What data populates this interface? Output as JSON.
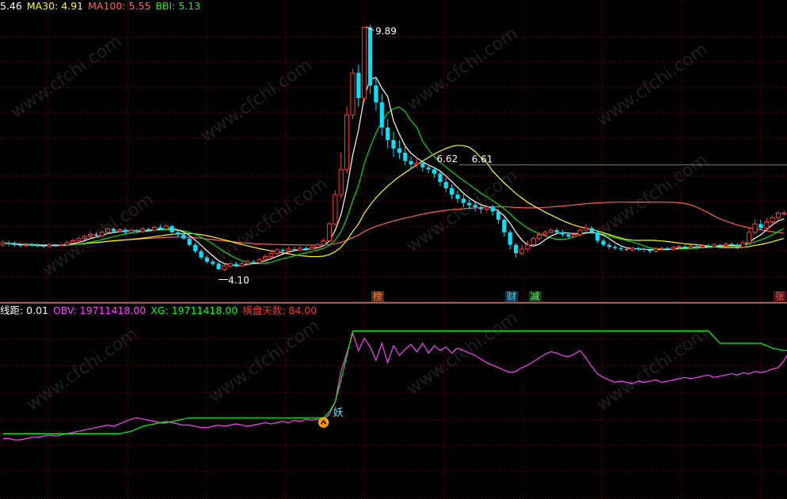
{
  "chart_data": [
    {
      "type": "candlestick",
      "legend": [
        {
          "label": "5.46",
          "color": "#ffffff"
        },
        {
          "label": "MA30: 4.91",
          "color": "#ffff00"
        },
        {
          "label": "MA100: 5.55",
          "color": "#ff5050"
        },
        {
          "label": "BBI: 5.13",
          "color": "#00ff00"
        }
      ],
      "ylim": [
        3.6,
        10.2
      ],
      "n": 140,
      "candles": [
        [
          4.7,
          4.75,
          4.82,
          4.65
        ],
        [
          4.75,
          4.72,
          4.8,
          4.68
        ],
        [
          4.72,
          4.7,
          4.78,
          4.66
        ],
        [
          4.7,
          4.68,
          4.74,
          4.64
        ],
        [
          4.68,
          4.7,
          4.75,
          4.65
        ],
        [
          4.7,
          4.69,
          4.74,
          4.66
        ],
        [
          4.69,
          4.68,
          4.72,
          4.64
        ],
        [
          4.68,
          4.66,
          4.71,
          4.62
        ],
        [
          4.66,
          4.7,
          4.74,
          4.64
        ],
        [
          4.7,
          4.68,
          4.73,
          4.65
        ],
        [
          4.68,
          4.7,
          4.74,
          4.66
        ],
        [
          4.7,
          4.75,
          4.8,
          4.68
        ],
        [
          4.75,
          4.8,
          4.85,
          4.72
        ],
        [
          4.8,
          4.85,
          4.9,
          4.78
        ],
        [
          4.85,
          4.9,
          4.95,
          4.82
        ],
        [
          4.9,
          4.95,
          5.0,
          4.86
        ],
        [
          4.95,
          4.92,
          5.0,
          4.88
        ],
        [
          4.92,
          5.0,
          5.05,
          4.9
        ],
        [
          5.0,
          5.08,
          5.12,
          4.96
        ],
        [
          5.08,
          5.02,
          5.12,
          4.98
        ],
        [
          5.02,
          5.06,
          5.1,
          5.0
        ],
        [
          5.06,
          5.0,
          5.1,
          4.96
        ],
        [
          5.0,
          5.05,
          5.09,
          4.97
        ],
        [
          5.05,
          5.02,
          5.08,
          4.98
        ],
        [
          5.02,
          5.08,
          5.12,
          5.0
        ],
        [
          5.08,
          5.05,
          5.12,
          5.02
        ],
        [
          5.05,
          5.12,
          5.16,
          5.02
        ],
        [
          5.12,
          5.08,
          5.18,
          5.04
        ],
        [
          5.08,
          5.15,
          5.2,
          5.05
        ],
        [
          5.15,
          5.0,
          5.18,
          4.98
        ],
        [
          5.0,
          4.95,
          5.05,
          4.9
        ],
        [
          4.95,
          4.85,
          4.98,
          4.82
        ],
        [
          4.85,
          4.7,
          4.9,
          4.66
        ],
        [
          4.7,
          4.55,
          4.75,
          4.5
        ],
        [
          4.55,
          4.4,
          4.6,
          4.35
        ],
        [
          4.4,
          4.3,
          4.45,
          4.25
        ],
        [
          4.3,
          4.25,
          4.35,
          4.2
        ],
        [
          4.25,
          4.12,
          4.3,
          4.1
        ],
        [
          4.12,
          4.2,
          4.25,
          4.08
        ],
        [
          4.2,
          4.25,
          4.3,
          4.15
        ],
        [
          4.25,
          4.2,
          4.3,
          4.16
        ],
        [
          4.2,
          4.25,
          4.3,
          4.18
        ],
        [
          4.25,
          4.3,
          4.35,
          4.2
        ],
        [
          4.3,
          4.28,
          4.34,
          4.24
        ],
        [
          4.28,
          4.35,
          4.4,
          4.26
        ],
        [
          4.35,
          4.42,
          4.48,
          4.32
        ],
        [
          4.42,
          4.5,
          4.55,
          4.4
        ],
        [
          4.5,
          4.58,
          4.62,
          4.46
        ],
        [
          4.58,
          4.55,
          4.62,
          4.5
        ],
        [
          4.55,
          4.6,
          4.66,
          4.52
        ],
        [
          4.6,
          4.58,
          4.66,
          4.55
        ],
        [
          4.58,
          4.62,
          4.68,
          4.55
        ],
        [
          4.62,
          4.6,
          4.66,
          4.56
        ],
        [
          4.6,
          4.65,
          4.7,
          4.58
        ],
        [
          4.65,
          4.7,
          4.75,
          4.62
        ],
        [
          4.7,
          4.8,
          4.85,
          4.66
        ],
        [
          4.8,
          5.2,
          5.25,
          4.78
        ],
        [
          5.2,
          5.9,
          6.0,
          5.15
        ],
        [
          5.9,
          6.5,
          6.9,
          5.8
        ],
        [
          6.5,
          7.8,
          8.0,
          6.4
        ],
        [
          7.8,
          8.8,
          8.9,
          7.7
        ],
        [
          8.8,
          8.2,
          9.0,
          8.0
        ],
        [
          8.2,
          9.89,
          9.89,
          8.1
        ],
        [
          9.89,
          8.5,
          9.95,
          8.3
        ],
        [
          8.5,
          8.1,
          8.7,
          7.9
        ],
        [
          8.1,
          7.5,
          8.3,
          7.3
        ],
        [
          7.5,
          7.2,
          7.7,
          7.0
        ],
        [
          7.2,
          7.0,
          7.4,
          6.8
        ],
        [
          7.0,
          6.9,
          7.2,
          6.75
        ],
        [
          6.9,
          6.7,
          7.05,
          6.6
        ],
        [
          6.7,
          6.62,
          6.8,
          6.5
        ],
        [
          6.62,
          6.65,
          6.75,
          6.55
        ],
        [
          6.65,
          6.55,
          6.72,
          6.45
        ],
        [
          6.55,
          6.5,
          6.62,
          6.4
        ],
        [
          6.5,
          6.4,
          6.55,
          6.3
        ],
        [
          6.4,
          6.2,
          6.45,
          6.1
        ],
        [
          6.2,
          6.05,
          6.3,
          5.95
        ],
        [
          6.05,
          5.9,
          6.15,
          5.8
        ],
        [
          5.9,
          5.8,
          6.0,
          5.7
        ],
        [
          5.8,
          5.7,
          5.9,
          5.6
        ],
        [
          5.7,
          5.65,
          5.78,
          5.55
        ],
        [
          5.65,
          5.6,
          5.72,
          5.5
        ],
        [
          5.6,
          5.55,
          5.68,
          5.45
        ],
        [
          5.55,
          5.6,
          5.65,
          5.48
        ],
        [
          5.6,
          5.5,
          5.66,
          5.4
        ],
        [
          5.5,
          5.3,
          5.55,
          5.2
        ],
        [
          5.3,
          5.0,
          5.35,
          4.9
        ],
        [
          5.0,
          4.7,
          5.05,
          4.6
        ],
        [
          4.7,
          4.5,
          4.75,
          4.4
        ],
        [
          4.5,
          4.6,
          4.7,
          4.45
        ],
        [
          4.6,
          4.7,
          4.8,
          4.55
        ],
        [
          4.7,
          4.85,
          4.9,
          4.65
        ],
        [
          4.85,
          4.95,
          5.0,
          4.8
        ],
        [
          4.95,
          5.0,
          5.05,
          4.9
        ],
        [
          5.0,
          5.05,
          5.1,
          4.95
        ],
        [
          5.05,
          5.0,
          5.1,
          4.95
        ],
        [
          5.0,
          4.95,
          5.05,
          4.9
        ],
        [
          4.95,
          4.9,
          5.0,
          4.85
        ],
        [
          4.9,
          4.95,
          5.0,
          4.86
        ],
        [
          4.95,
          5.05,
          5.1,
          4.9
        ],
        [
          5.05,
          5.1,
          5.2,
          5.0
        ],
        [
          5.1,
          5.0,
          5.15,
          4.95
        ],
        [
          5.0,
          4.8,
          5.05,
          4.75
        ],
        [
          4.8,
          4.7,
          4.85,
          4.65
        ],
        [
          4.7,
          4.65,
          4.75,
          4.6
        ],
        [
          4.65,
          4.62,
          4.7,
          4.58
        ],
        [
          4.62,
          4.6,
          4.68,
          4.55
        ],
        [
          4.6,
          4.58,
          4.64,
          4.55
        ],
        [
          4.58,
          4.62,
          4.66,
          4.55
        ],
        [
          4.62,
          4.6,
          4.66,
          4.56
        ],
        [
          4.6,
          4.58,
          4.64,
          4.54
        ],
        [
          4.58,
          4.55,
          4.62,
          4.5
        ],
        [
          4.55,
          4.6,
          4.65,
          4.52
        ],
        [
          4.6,
          4.62,
          4.67,
          4.56
        ],
        [
          4.62,
          4.6,
          4.66,
          4.56
        ],
        [
          4.6,
          4.64,
          4.68,
          4.57
        ],
        [
          4.64,
          4.66,
          4.7,
          4.6
        ],
        [
          4.66,
          4.63,
          4.7,
          4.6
        ],
        [
          4.63,
          4.66,
          4.7,
          4.6
        ],
        [
          4.66,
          4.65,
          4.7,
          4.62
        ],
        [
          4.65,
          4.68,
          4.72,
          4.62
        ],
        [
          4.68,
          4.66,
          4.72,
          4.63
        ],
        [
          4.66,
          4.7,
          4.74,
          4.64
        ],
        [
          4.7,
          4.68,
          4.73,
          4.65
        ],
        [
          4.68,
          4.72,
          4.76,
          4.65
        ],
        [
          4.72,
          4.7,
          4.76,
          4.66
        ],
        [
          4.7,
          4.65,
          4.74,
          4.6
        ],
        [
          4.65,
          4.75,
          4.8,
          4.62
        ],
        [
          4.75,
          5.0,
          5.1,
          4.72
        ],
        [
          5.0,
          5.2,
          5.3,
          4.95
        ],
        [
          5.2,
          5.1,
          5.3,
          5.05
        ],
        [
          5.1,
          5.25,
          5.35,
          5.05
        ],
        [
          5.25,
          5.35,
          5.4,
          5.2
        ],
        [
          5.35,
          5.46,
          5.5,
          5.3
        ],
        [
          5.46,
          5.46,
          5.5,
          5.4
        ]
      ],
      "annotations": [
        {
          "text": "9.89",
          "index": 62,
          "value": 9.89
        },
        {
          "text": "6.62",
          "index": 74,
          "value": 6.62
        },
        {
          "text": "6.61",
          "index": 80,
          "value": 6.61
        },
        {
          "text": "4.10",
          "index": 37,
          "value": 4.1
        }
      ],
      "markers": [
        {
          "text": "榜",
          "index": 64,
          "color": "#ff8040",
          "bg": "#5a2e10"
        },
        {
          "text": "财",
          "index": 87,
          "color": "#40e0ff",
          "bg": "#10384a"
        },
        {
          "text": "减",
          "index": 91,
          "color": "#60ff60",
          "bg": "#103a14"
        },
        {
          "text": "张",
          "index": 133,
          "color": "#ff5050",
          "bg": "#4a1414"
        }
      ],
      "colors": {
        "up": "#ff3a3a",
        "down": "#00e5ff",
        "ma_white": "#ffffff",
        "ma30": "#ffff00",
        "ma100": "#ff6060",
        "bbi": "#00e000",
        "grid": "#7a0000"
      }
    },
    {
      "type": "line",
      "legend": [
        {
          "label": "线距: 0.01",
          "color": "#ffffff"
        },
        {
          "label": "OBV: 19711418.00",
          "color": "#ff40ff"
        },
        {
          "label": "XG: 19711418.00",
          "color": "#00ff00"
        },
        {
          "label": "横盘天数: 84.00",
          "color": "#ff3030"
        }
      ],
      "signal": {
        "text": "妖",
        "index": 55
      },
      "series": [
        {
          "name": "OBV",
          "color": "#ff40ff",
          "values": [
            10.0,
            10.0,
            9.9,
            9.9,
            10.0,
            10.1,
            10.1,
            10.2,
            10.3,
            10.2,
            10.3,
            10.4,
            10.5,
            10.6,
            10.7,
            10.8,
            10.9,
            11.0,
            11.1,
            11.0,
            11.2,
            11.4,
            11.6,
            11.7,
            11.6,
            11.5,
            11.4,
            11.3,
            11.4,
            11.3,
            11.2,
            11.1,
            11.1,
            11.0,
            10.9,
            10.9,
            11.0,
            11.1,
            11.0,
            11.1,
            11.2,
            11.1,
            11.0,
            11.1,
            11.2,
            11.3,
            11.2,
            11.3,
            11.4,
            11.3,
            11.5,
            11.4,
            11.6,
            11.5,
            11.6,
            11.5,
            12.0,
            13.0,
            15.5,
            17.0,
            18.6,
            17.2,
            18.2,
            17.5,
            16.4,
            17.8,
            16.2,
            17.6,
            16.8,
            17.3,
            17.7,
            17.1,
            17.8,
            17.0,
            17.6,
            17.2,
            17.5,
            17.0,
            17.4,
            17.2,
            17.0,
            16.8,
            16.5,
            16.2,
            16.0,
            15.8,
            15.6,
            15.4,
            15.5,
            15.8,
            16.0,
            16.3,
            16.6,
            16.9,
            17.1,
            17.0,
            16.8,
            16.7,
            16.9,
            17.2,
            16.6,
            15.9,
            15.3,
            15.0,
            14.8,
            14.6,
            14.7,
            14.6,
            14.5,
            14.7,
            14.6,
            14.7,
            14.8,
            14.6,
            14.7,
            14.8,
            14.9,
            15.0,
            14.9,
            15.0,
            15.1,
            15.2,
            15.0,
            15.1,
            15.2,
            15.3,
            15.2,
            15.4,
            15.3,
            15.5,
            15.4,
            15.5,
            15.7,
            15.8,
            16.4,
            17.2,
            16.9,
            17.4,
            17.2,
            17.5
          ]
        },
        {
          "name": "XG",
          "color": "#00ff00",
          "values": [
            10.4,
            10.4,
            10.4,
            10.4,
            10.4,
            10.4,
            10.4,
            10.4,
            10.4,
            10.4,
            10.4,
            10.4,
            10.4,
            10.4,
            10.4,
            10.4,
            10.4,
            10.4,
            10.4,
            10.4,
            10.4,
            10.5,
            10.6,
            10.8,
            11.0,
            11.1,
            11.2,
            11.3,
            11.3,
            11.4,
            11.5,
            11.6,
            11.7,
            11.7,
            11.7,
            11.7,
            11.7,
            11.7,
            11.7,
            11.7,
            11.7,
            11.7,
            11.7,
            11.7,
            11.7,
            11.7,
            11.7,
            11.7,
            11.7,
            11.7,
            11.7,
            11.7,
            11.7,
            11.7,
            11.7,
            11.7,
            12.2,
            13.0,
            14.8,
            16.8,
            18.8,
            18.8,
            18.8,
            18.8,
            18.8,
            18.8,
            18.8,
            18.8,
            18.8,
            18.8,
            18.8,
            18.8,
            18.8,
            18.8,
            18.8,
            18.8,
            18.8,
            18.8,
            18.8,
            18.8,
            18.8,
            18.8,
            18.8,
            18.8,
            18.8,
            18.8,
            18.8,
            18.8,
            18.8,
            18.8,
            18.8,
            18.8,
            18.8,
            18.8,
            18.8,
            18.8,
            18.8,
            18.8,
            18.8,
            18.8,
            18.8,
            18.8,
            18.8,
            18.8,
            18.8,
            18.8,
            18.8,
            18.8,
            18.8,
            18.8,
            18.8,
            18.8,
            18.8,
            18.8,
            18.8,
            18.8,
            18.8,
            18.8,
            18.8,
            18.8,
            18.8,
            18.8,
            18.3,
            17.8,
            17.8,
            17.8,
            17.8,
            17.8,
            17.8,
            17.8,
            17.8,
            17.6,
            17.4,
            17.3,
            17.2,
            17.2,
            17.2,
            17.2,
            17.2,
            17.2,
            17.2,
            17.2,
            17.2
          ]
        }
      ],
      "ylim": [
        9.0,
        20.0
      ]
    }
  ],
  "watermark": "www.cfchi.com"
}
